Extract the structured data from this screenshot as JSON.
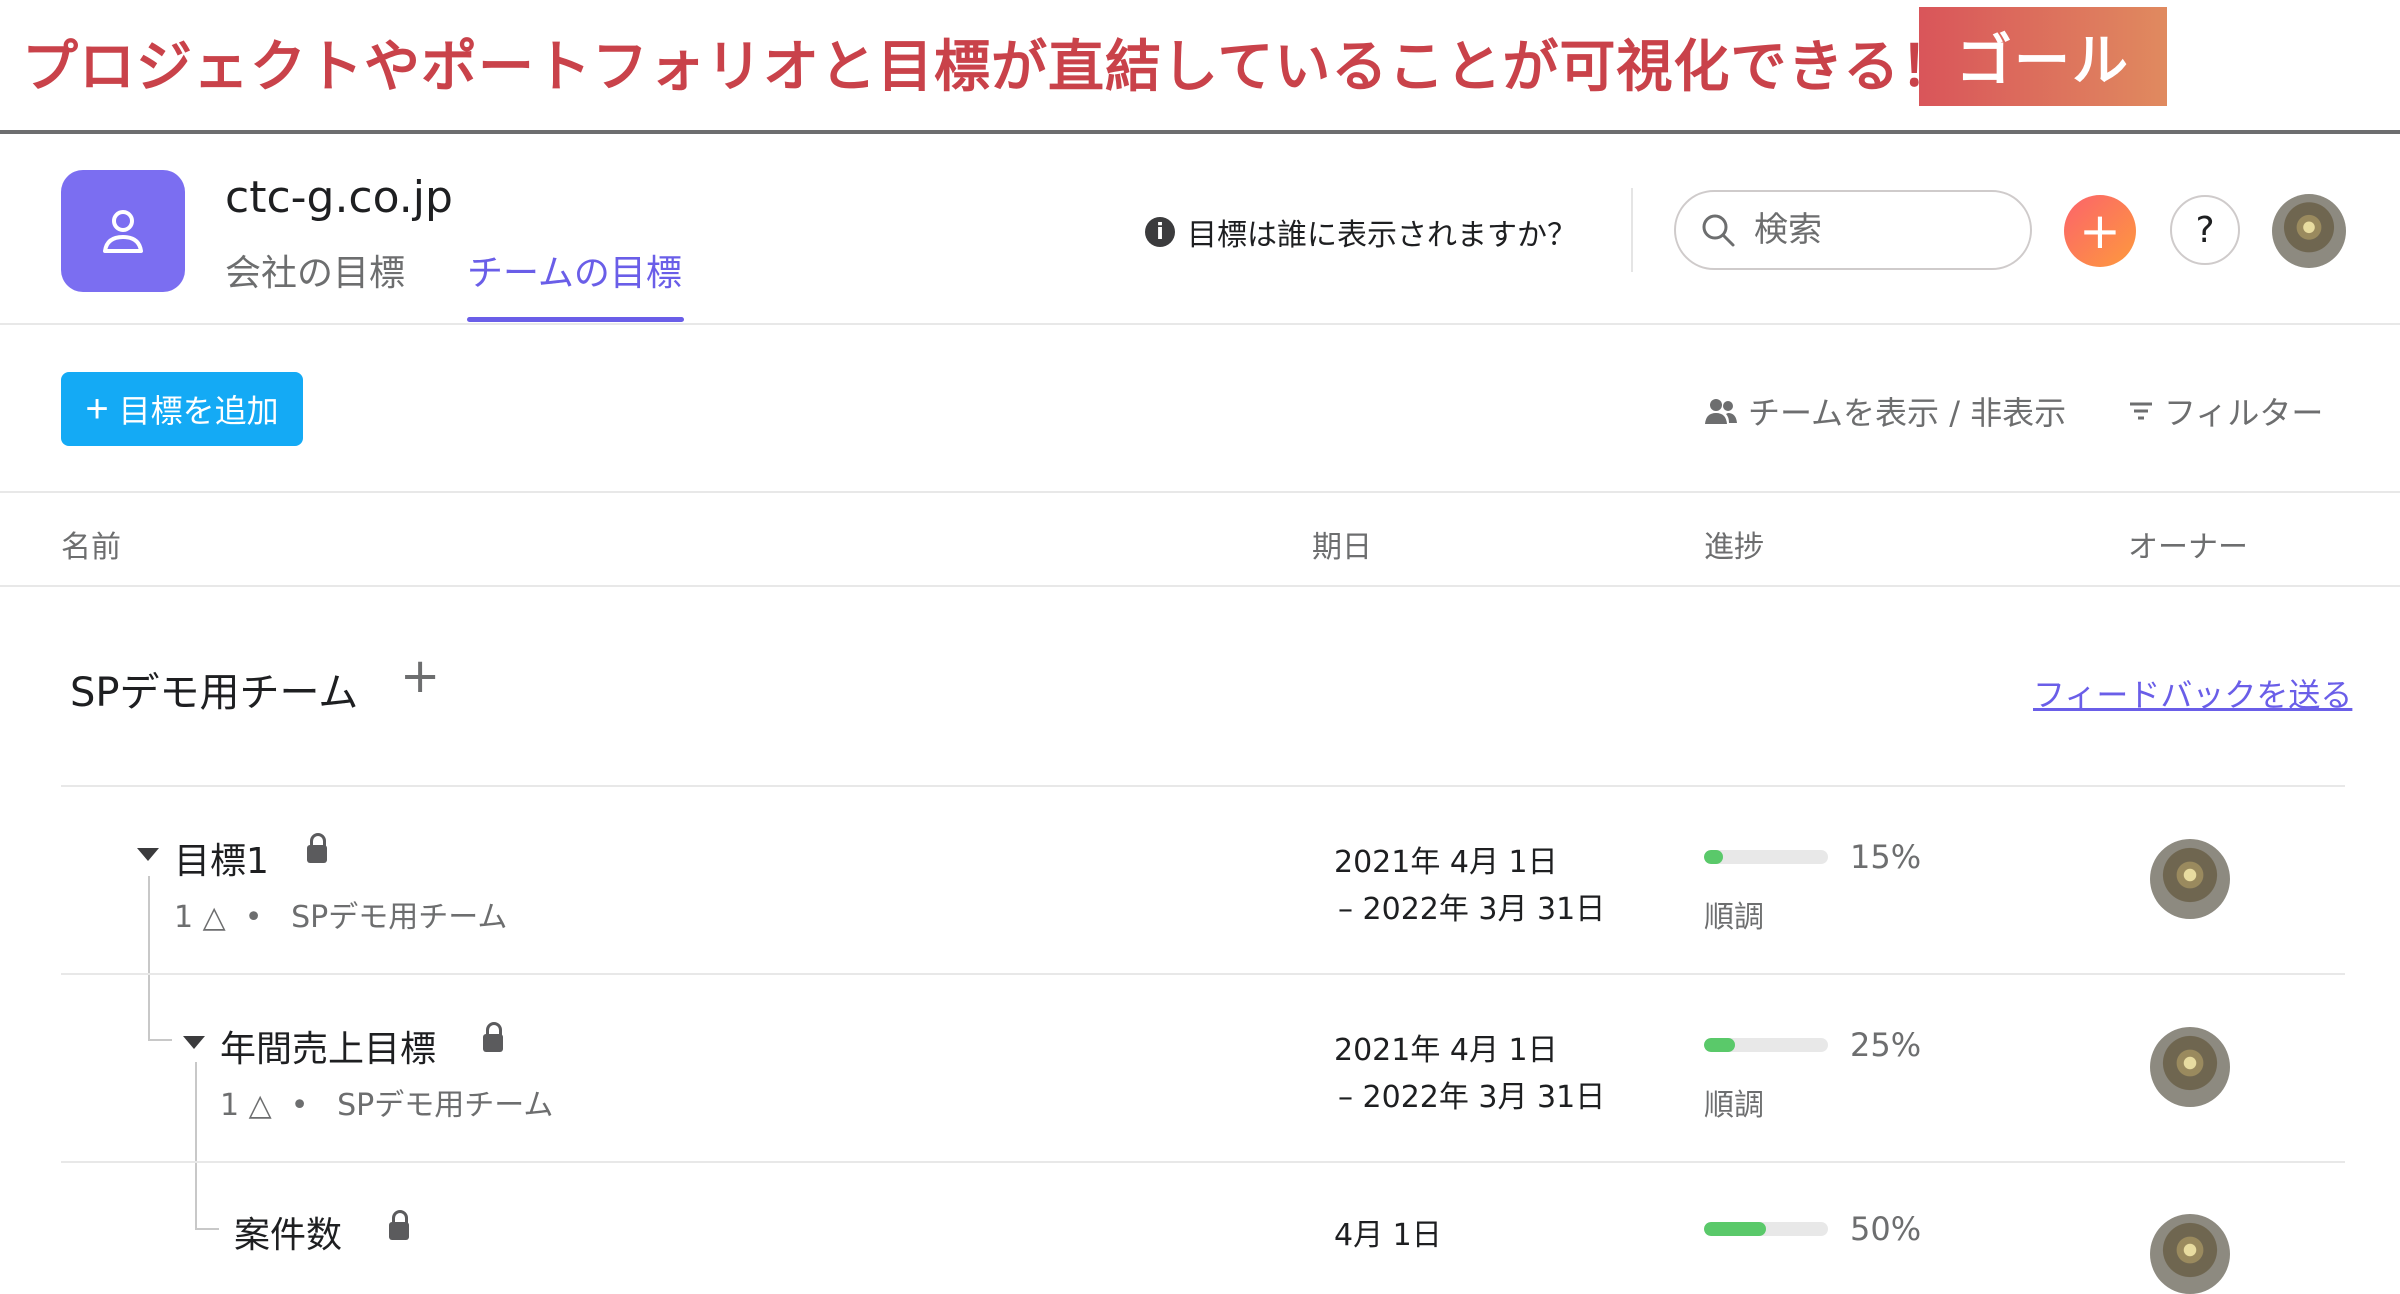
{
  "banner": {
    "text": "プロジェクトやポートフォリオと目標が直結していることが可視化できる！",
    "tag": "ゴール"
  },
  "header": {
    "org_name": "ctc-g.co.jp",
    "tabs": [
      {
        "label": "会社の目標",
        "active": false
      },
      {
        "label": "チームの目標",
        "active": true
      }
    ],
    "info_text": "目標は誰に表示されますか？",
    "search_placeholder": "検索",
    "help_label": "?"
  },
  "toolbar": {
    "add_goal_label": "目標を追加",
    "show_hide_teams": "チームを表示 / 非表示",
    "filter": "フィルター"
  },
  "columns": {
    "name": "名前",
    "due": "期日",
    "progress": "進捗",
    "owner": "オーナー"
  },
  "team": {
    "name": "SPデモ用チーム",
    "feedback_link": "フィードバックを送る"
  },
  "goals": [
    {
      "name": "目標1",
      "sub_count": "1",
      "team": "SPデモ用チーム",
      "start": "2021年 4月 1日",
      "end": "– 2022年 3月 31日",
      "progress": 15,
      "progress_label": "15%",
      "status": "順調"
    },
    {
      "name": "年間売上目標",
      "sub_count": "1",
      "team": "SPデモ用チーム",
      "start": "2021年 4月 1日",
      "end": "– 2022年 3月 31日",
      "progress": 25,
      "progress_label": "25%",
      "status": "順調"
    },
    {
      "name": "案件数",
      "start": "4月 1日",
      "progress": 50,
      "progress_label": "50%"
    }
  ],
  "colors": {
    "accent": "#6a5ee8",
    "primary_button": "#14aaf5",
    "progress_on_track": "#5ac96a",
    "banner_text": "#c9424a"
  }
}
